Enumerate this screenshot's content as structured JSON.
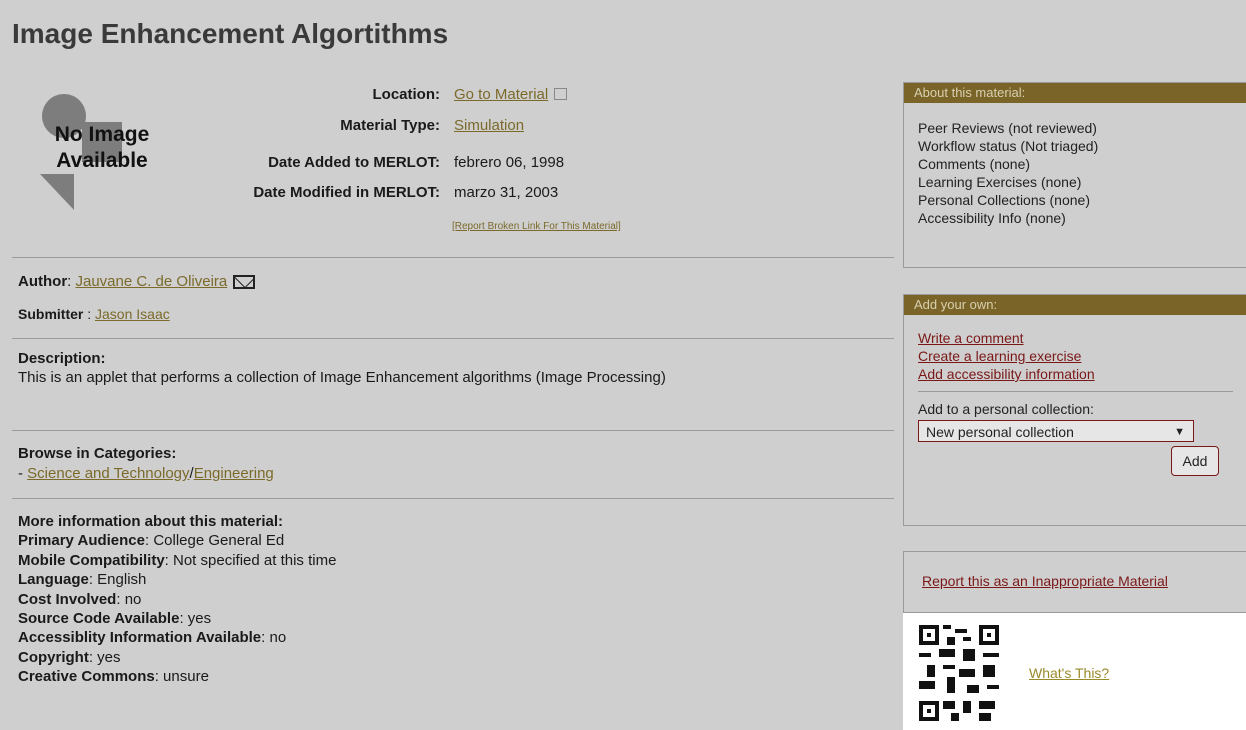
{
  "page": {
    "title": "Image Enhancement Algortithms"
  },
  "no_image": {
    "line1": "No Image",
    "line2": "Available"
  },
  "meta": {
    "location_label": "Location:",
    "location_value": "Go to Material",
    "type_label": "Material Type:",
    "type_value": "Simulation",
    "added_label": "Date Added to MERLOT:",
    "added_value": "febrero 06, 1998",
    "modified_label": "Date Modified in MERLOT:",
    "modified_value": "marzo 31, 2003",
    "report_broken": "[Report Broken Link For This Material]"
  },
  "author": {
    "label": "Author",
    "name": "Jauvane C. de Oliveira"
  },
  "submitter": {
    "label": "Submitter",
    "name": "Jason Isaac"
  },
  "description": {
    "label": "Description:",
    "text": "This is an applet that performs a collection of Image Enhancement algorithms (Image Processing)"
  },
  "categories": {
    "label": "Browse in Categories:",
    "prefix": "- ",
    "cat1": "Science and Technology",
    "sep": "/",
    "cat2": "Engineering"
  },
  "more_info": {
    "label": "More information about this material:",
    "items": [
      {
        "k": "Primary Audience",
        "v": ": College General Ed"
      },
      {
        "k": "Mobile Compatibility",
        "v": ": Not specified at this time"
      },
      {
        "k": "Language",
        "v": ": English"
      },
      {
        "k": "Cost Involved",
        "v": ": no"
      },
      {
        "k": "Source Code Available",
        "v": ": yes"
      },
      {
        "k": "Accessiblity Information Available",
        "v": ": no"
      },
      {
        "k": "Copyright",
        "v": ": yes"
      },
      {
        "k": "Creative Commons",
        "v": ": unsure"
      }
    ]
  },
  "about_panel": {
    "header": "About this material:",
    "items": [
      "Peer Reviews (not reviewed)",
      "Workflow status (Not triaged)",
      "Comments (none)",
      "Learning Exercises (none)",
      "Personal Collections (none)",
      "Accessibility Info (none)"
    ]
  },
  "add_panel": {
    "header": "Add your own:",
    "links": [
      "Write a comment",
      "Create a learning exercise",
      "Add accessibility information"
    ],
    "collection_label": "Add to a personal collection:",
    "collection_selected": "New personal collection",
    "add_button": "Add"
  },
  "report_panel": {
    "link": "Report this as an Inappropriate Material"
  },
  "qr": {
    "whats_this": "What's This?"
  },
  "colors": {
    "accent": "#7a6428",
    "link": "#7b6a2a",
    "alert_link": "#7a1818",
    "background": "#cfcfcf"
  }
}
